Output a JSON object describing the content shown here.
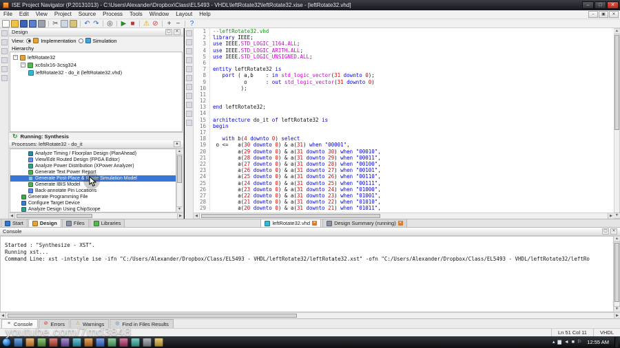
{
  "window": {
    "title": "ISE Project Navigator (P.20131013) - C:\\Users\\Alexander\\Dropbox\\Class\\EL5493 - VHDL\\leftRotate32\\leftRotate32.xise - [leftRotate32.vhd]"
  },
  "menu": {
    "items": [
      "File",
      "Edit",
      "View",
      "Project",
      "Source",
      "Process",
      "Tools",
      "Window",
      "Layout",
      "Help"
    ]
  },
  "toolbar": {
    "main_icons": [
      "new-document-icon",
      "open-project-icon",
      "save-icon",
      "save-all-icon",
      "print-icon",
      "sep",
      "cut-icon",
      "copy-icon",
      "paste-icon",
      "sep",
      "undo-icon",
      "redo-icon",
      "sep",
      "find-icon",
      "sep",
      "run-icon",
      "stop-icon",
      "sep",
      "warning-icon",
      "error-icon",
      "sep",
      "zoom-in-icon",
      "zoom-out-icon",
      "sep",
      "help-icon"
    ],
    "left_strip_icons": [
      "collapse-all-icon",
      "expand-all-icon",
      "up-icon",
      "down-icon",
      "refresh-icon",
      "properties-icon"
    ],
    "editor_strip_icons": [
      "fold-icon",
      "unfold-icon",
      "bookmark-icon",
      "goto-icon",
      "indent-icon",
      "outdent-icon",
      "comment-icon",
      "uncomment-icon",
      "check-syntax-icon",
      "snippet-icon",
      "macro-icon"
    ]
  },
  "design_panel": {
    "title": "Design",
    "view": {
      "label": "View:",
      "options": [
        {
          "label": "Implementation",
          "selected": true,
          "icon": "implementation-icon"
        },
        {
          "label": "Simulation",
          "selected": false,
          "icon": "simulation-icon"
        }
      ]
    },
    "hierarchy": {
      "label": "Hierarchy",
      "items": [
        {
          "label": "leftRotate32",
          "icon": "project-icon",
          "indent": 0,
          "expander": true
        },
        {
          "label": "xc6slx16-3csg324",
          "icon": "device-icon",
          "indent": 1,
          "expander": true
        },
        {
          "label": "leftRotate32 - do_it (leftRotate32.vhd)",
          "icon": "vhdl-file-icon",
          "indent": 2,
          "expander": false
        }
      ]
    },
    "running_status": "Running: Synthesis",
    "processes": {
      "title": "Processes: leftRotate32 - do_it",
      "items": [
        {
          "label": "Analyze Timing / Floorplan Design (PlanAhead)",
          "icon": "planahead-icon",
          "indent": 2,
          "selected": false
        },
        {
          "label": "View/Edit Routed Design (FPGA Editor)",
          "icon": "fpga-editor-icon",
          "indent": 2,
          "selected": false
        },
        {
          "label": "Analyze Power Distribution (XPower Analyzer)",
          "icon": "xpower-icon",
          "indent": 2,
          "selected": false
        },
        {
          "label": "Generate Text Power Report",
          "icon": "power-report-icon",
          "indent": 2,
          "selected": false
        },
        {
          "label": "Generate Post-Place & Route Simulation Model",
          "icon": "simulation-model-icon",
          "indent": 2,
          "selected": true
        },
        {
          "label": "Generate IBIS Model",
          "icon": "ibis-model-icon",
          "indent": 2,
          "selected": false
        },
        {
          "label": "Back-annotate Pin Locations",
          "icon": "pin-locations-icon",
          "indent": 2,
          "selected": false
        },
        {
          "label": "Generate Programming File",
          "icon": "programming-file-icon",
          "indent": 1,
          "selected": false
        },
        {
          "label": "Configure Target Device",
          "icon": "target-device-icon",
          "indent": 1,
          "selected": false
        },
        {
          "label": "Analyze Design Using ChipScope",
          "icon": "chipscope-icon",
          "indent": 1,
          "selected": false
        }
      ]
    },
    "side_tabs": [
      {
        "label": "Start",
        "icon": "start-tab-icon",
        "active": false
      },
      {
        "label": "Design",
        "icon": "design-tab-icon",
        "active": true
      },
      {
        "label": "Files",
        "icon": "files-tab-icon",
        "active": false
      },
      {
        "label": "Libraries",
        "icon": "libraries-tab-icon",
        "active": false
      }
    ]
  },
  "editor": {
    "doc_tabs": [
      {
        "label": "leftRotate32.vhd",
        "icon": "vhdl-file-icon",
        "active": true
      },
      {
        "label": "Design Summary (running)",
        "icon": "summary-tab-icon",
        "active": false
      }
    ],
    "lines": [
      "--leftRotate32.vhd",
      "library IEEE;",
      "use IEEE.STD_LOGIC_1164.ALL;",
      "use IEEE.STD_LOGIC_ARITH.ALL;",
      "use IEEE.STD_LOGIC_UNSIGNED.ALL;",
      "",
      "entity leftRotate32 is",
      "   port ( a,b    : in std_logic_vector(31 downto 0);",
      "          o      : out std_logic_vector(31 downto 0)",
      "         );",
      "",
      "",
      "end leftRotate32;",
      "",
      "architecture do_it of leftRotate32 is",
      "begin",
      "",
      "   with b(4 downto 0) select",
      " o <=   a(30 downto 0) & a(31) when \"00001\",",
      "        a(29 downto 0) & a(31 downto 30) when \"00010\",",
      "        a(28 downto 0) & a(31 downto 29) when \"00011\",",
      "        a(27 downto 0) & a(31 downto 28) when \"00100\",",
      "        a(26 downto 0) & a(31 downto 27) when \"00101\",",
      "        a(25 downto 0) & a(31 downto 26) when \"00110\",",
      "        a(24 downto 0) & a(31 downto 25) when \"00111\",",
      "        a(23 downto 0) & a(31 downto 24) when \"01000\",",
      "        a(22 downto 0) & a(31 downto 23) when \"01001\",",
      "        a(21 downto 0) & a(31 downto 22) when \"01010\",",
      "        a(20 downto 0) & a(31 downto 21) when \"01011\","
    ]
  },
  "console": {
    "title": "Console",
    "lines": [
      "Started : \"Synthesize - XST\".",
      "Running xst...",
      "Command Line: xst -intstyle ise -ifn \"C:/Users/Alexander/Dropbox/Class/EL5493 - VHDL/leftRotate32/leftRotate32.xst\" -ofn \"C:/Users/Alexander/Dropbox/Class/EL5493 - VHDL/leftRotate32/leftRo"
    ],
    "tabs": [
      {
        "label": "Console",
        "icon": "console-tab-icon",
        "active": true
      },
      {
        "label": "Errors",
        "icon": "errors-icon",
        "active": false
      },
      {
        "label": "Warnings",
        "icon": "warnings-icon",
        "active": false
      },
      {
        "label": "Find in Files Results",
        "icon": "find-results-icon",
        "active": false
      }
    ]
  },
  "status": {
    "line_col": "Ln 51 Col 11",
    "language": "VHDL"
  },
  "taskbar": {
    "time": "12:55 AM",
    "apps": [
      "taskbar-app-1",
      "taskbar-app-2",
      "taskbar-app-3",
      "taskbar-app-4",
      "taskbar-app-5",
      "taskbar-app-6",
      "taskbar-app-7",
      "taskbar-app-8",
      "taskbar-app-9",
      "taskbar-app-10",
      "taskbar-app-11",
      "taskbar-app-12",
      "taskbar-app-13"
    ],
    "tray_icons": [
      "tray-arrow-icon",
      "tray-network-icon",
      "tray-volume-icon",
      "tray-update-icon",
      "tray-flag-icon"
    ]
  },
  "watermark": {
    "text": "youtube.com/7md3848"
  }
}
